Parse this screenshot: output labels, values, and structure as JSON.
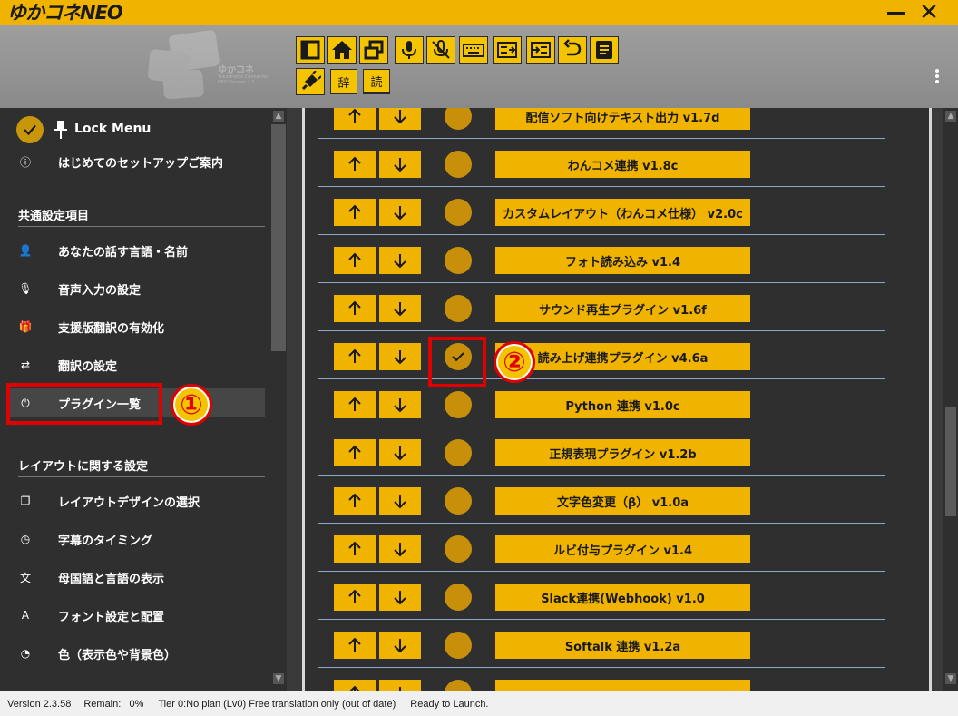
{
  "app": {
    "title": "ゆかコネNEO"
  },
  "logo": {
    "text": "ゆかコネ",
    "subtext": "Yukarinette Connector NEO Version 2.3"
  },
  "toolbar": {
    "dict_label": "辞",
    "read_label": "読",
    "buttons": [
      "layout-icon",
      "home-icon",
      "windows-icon",
      "mic-icon",
      "mic-off-icon",
      "keyboard-icon",
      "input-export-icon",
      "input-import-icon",
      "undo-icon",
      "document-icon",
      "plug-icon"
    ]
  },
  "sidebar": {
    "lock_menu": "Lock Menu",
    "setup_guide": "はじめてのセットアップご案内",
    "section_common": "共通設定項目",
    "section_layout": "レイアウトに関する設定",
    "common_items": [
      {
        "label": "あなたの話す言語・名前",
        "icon": "speaker-icon"
      },
      {
        "label": "音声入力の設定",
        "icon": "mic-icon"
      },
      {
        "label": "支援版翻訳の有効化",
        "icon": "gift-icon"
      },
      {
        "label": "翻訳の設定",
        "icon": "translate-icon"
      },
      {
        "label": "プラグイン一覧",
        "icon": "plug-icon"
      }
    ],
    "layout_items": [
      {
        "label": "レイアウトデザインの選択",
        "icon": "windows-icon"
      },
      {
        "label": "字幕のタイミング",
        "icon": "clock-icon"
      },
      {
        "label": "母国語と言語の表示",
        "icon": "language-icon"
      },
      {
        "label": "フォント設定と配置",
        "icon": "font-icon"
      },
      {
        "label": "色（表示色や背景色）",
        "icon": "palette-icon"
      }
    ]
  },
  "plugins": [
    {
      "name": "配信ソフト向けテキスト出力 v1.7d",
      "enabled": false
    },
    {
      "name": "わんコメ連携 v1.8c",
      "enabled": false
    },
    {
      "name": "カスタムレイアウト（わんコメ仕様） v2.0c",
      "enabled": false
    },
    {
      "name": "フォト読み込み v1.4",
      "enabled": false
    },
    {
      "name": "サウンド再生プラグイン v1.6f",
      "enabled": false
    },
    {
      "name": "読み上げ連携プラグイン v4.6a",
      "enabled": true
    },
    {
      "name": "Python 連携 v1.0c",
      "enabled": false
    },
    {
      "name": "正規表現プラグイン v1.2b",
      "enabled": false
    },
    {
      "name": "文字色変更（β） v1.0a",
      "enabled": false
    },
    {
      "name": "ルビ付与プラグイン v1.4",
      "enabled": false
    },
    {
      "name": "Slack連携(Webhook) v1.0",
      "enabled": false
    },
    {
      "name": "Softalk 連携 v1.2a",
      "enabled": false
    },
    {
      "name": "",
      "enabled": false
    }
  ],
  "annotations": {
    "one": "①",
    "two": "②"
  },
  "status": {
    "version": "Version 2.3.58",
    "remain": "Remain:   0%",
    "tier": "Tier 0:No plan (Lv0) Free translation only (out of date)",
    "state": "Ready to Launch."
  },
  "colors": {
    "accent": "#f0b400",
    "toggle": "#c8900a",
    "panel": "#2f2f2f",
    "annotation": "#e00000"
  }
}
